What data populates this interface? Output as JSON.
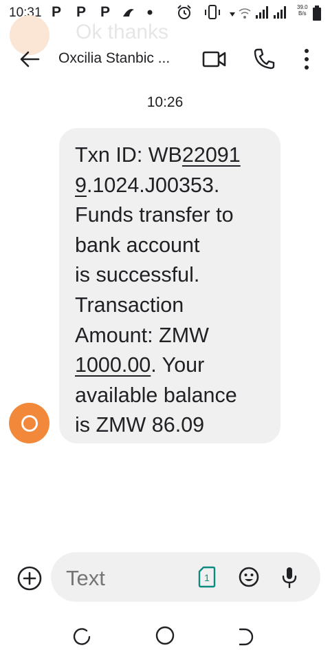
{
  "status_bar": {
    "time": "10:31",
    "p_icons": [
      "P",
      "P",
      "P"
    ],
    "net_speed_value": "39.0",
    "net_speed_unit": "B/s",
    "icons": [
      "notification-dot-icon",
      "alarm-icon",
      "vibrate-icon",
      "wifi-icon",
      "signal-icon",
      "battery-icon"
    ]
  },
  "ghost_notification": {
    "text": "Ok thanks"
  },
  "app_bar": {
    "title": "Oxcilia Stanbic ...",
    "icons": [
      "back-arrow-icon",
      "video-call-icon",
      "phone-icon",
      "more-vert-icon"
    ]
  },
  "message": {
    "timestamp": "10:26",
    "lines": [
      {
        "before": "Txn ID: WB",
        "link": "22091",
        "after": ""
      },
      {
        "before": "",
        "link": "9",
        "after": ".1024.J00353."
      },
      {
        "before": "Funds transfer to",
        "link": "",
        "after": ""
      },
      {
        "before": "bank account",
        "link": "",
        "after": ""
      },
      {
        "before": "is successful.",
        "link": "",
        "after": ""
      },
      {
        "before": "Transaction",
        "link": "",
        "after": ""
      },
      {
        "before": "Amount: ZMW",
        "link": "",
        "after": ""
      },
      {
        "before": "",
        "link": "1000.00",
        "after": ". Your"
      },
      {
        "before": "available balance",
        "link": "",
        "after": ""
      },
      {
        "before": "is ZMW 86.09",
        "link": "",
        "after": ""
      }
    ],
    "avatar_color": "#f2893a"
  },
  "compose": {
    "placeholder": "Text",
    "sim_label": "1",
    "icons": [
      "add-circle-icon",
      "sim-card-icon",
      "emoji-icon",
      "mic-icon"
    ]
  },
  "colors": {
    "bubble": "#f0f0f0",
    "accent_sim": "#0b8a80",
    "avatar": "#f2893a"
  },
  "nav_bar": {
    "icons": [
      "recents-icon",
      "home-icon",
      "back-icon"
    ]
  }
}
